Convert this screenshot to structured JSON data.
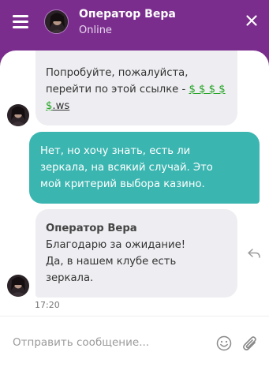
{
  "header": {
    "title": "Оператор Вера",
    "status": "Online",
    "menu_icon": "hamburger-menu-icon",
    "close_icon": "close-icon",
    "background": "#7b2d8e"
  },
  "messages": [
    {
      "from": "operator",
      "text": "Попробуйте, пожалуйста, перейти по этой ссылке -",
      "link": "$ $ $ $ $",
      "link_suffix": ".ws"
    },
    {
      "from": "user",
      "text_lines": [
        "Нет, но хочу знать, есть ли",
        "зеркала, на всякий случай. Это",
        "мой критерий выбора казино."
      ]
    },
    {
      "from": "operator",
      "sender": "Оператор Вера",
      "text_lines": [
        "Благодарю за ожидание!",
        "Да, в нашем клубе есть",
        "зеркала."
      ],
      "time": "17:20"
    }
  ],
  "input": {
    "placeholder": "Отправить сообщение...",
    "value": ""
  },
  "colors": {
    "accent": "#7b2d8e",
    "user_bubble": "#3bb5b0",
    "operator_bubble": "#eeeef2",
    "link": "#21a321"
  }
}
